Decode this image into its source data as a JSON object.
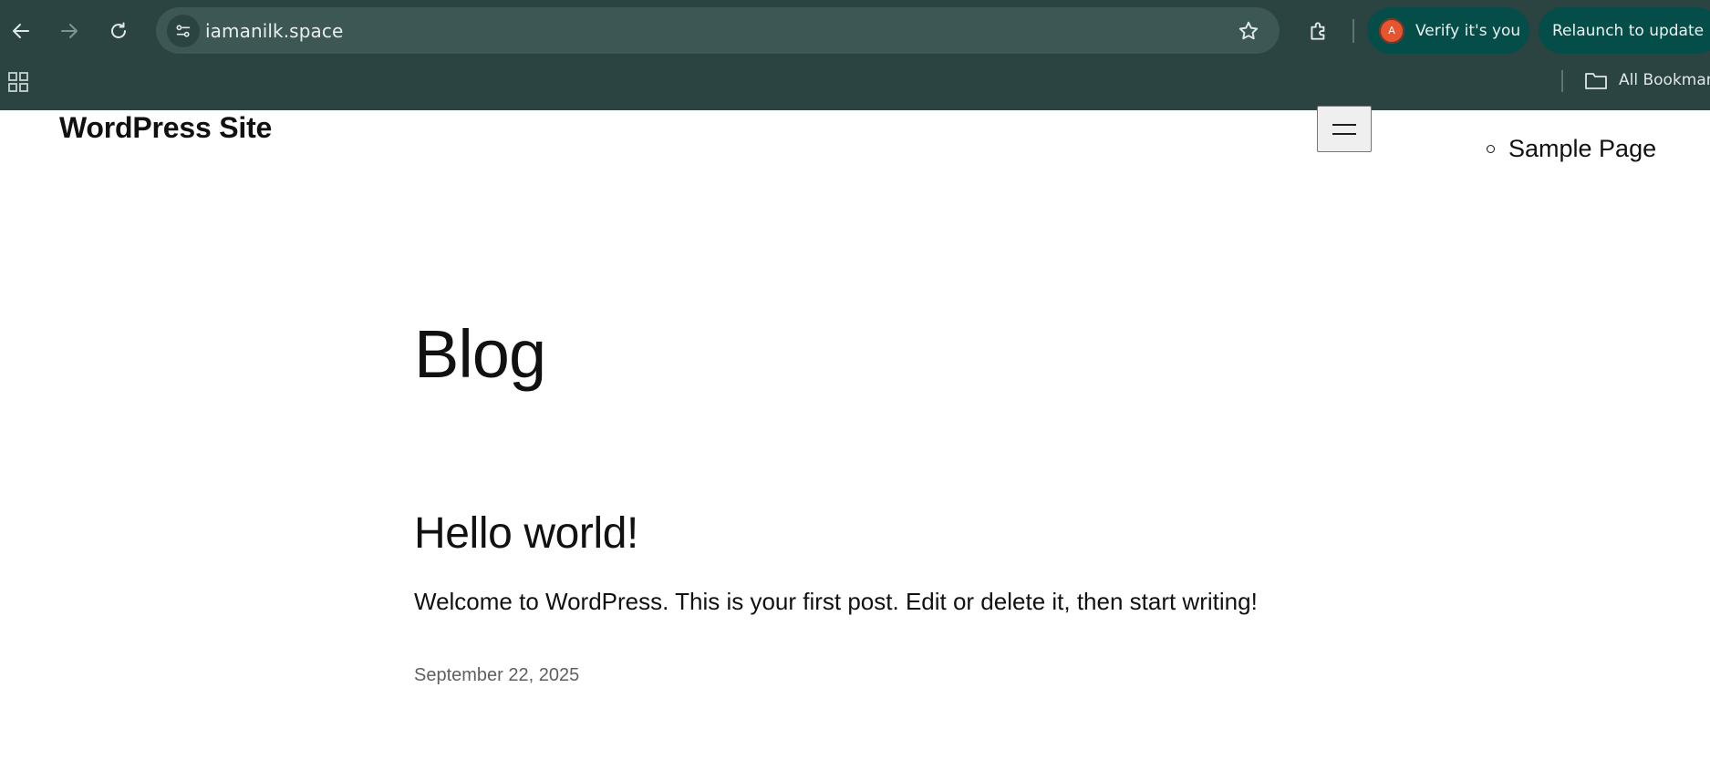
{
  "browser": {
    "url": "iamanilk.space",
    "verify_label": "Verify it's you",
    "avatar_letter": "A",
    "relaunch_label": "Relaunch to update",
    "bookmarks_label": "All Bookmarks",
    "colors": {
      "frame": "#2b4341",
      "omnibox": "#3c5754",
      "pill": "#054d48",
      "avatar": "#e8542d"
    }
  },
  "site": {
    "title": "WordPress Site",
    "nav": [
      {
        "label": "Sample Page"
      }
    ]
  },
  "main": {
    "heading": "Blog",
    "posts": [
      {
        "title": "Hello world!",
        "excerpt": "Welcome to WordPress. This is your first post. Edit or delete it, then start writing!",
        "date": "September 22, 2025"
      }
    ]
  }
}
